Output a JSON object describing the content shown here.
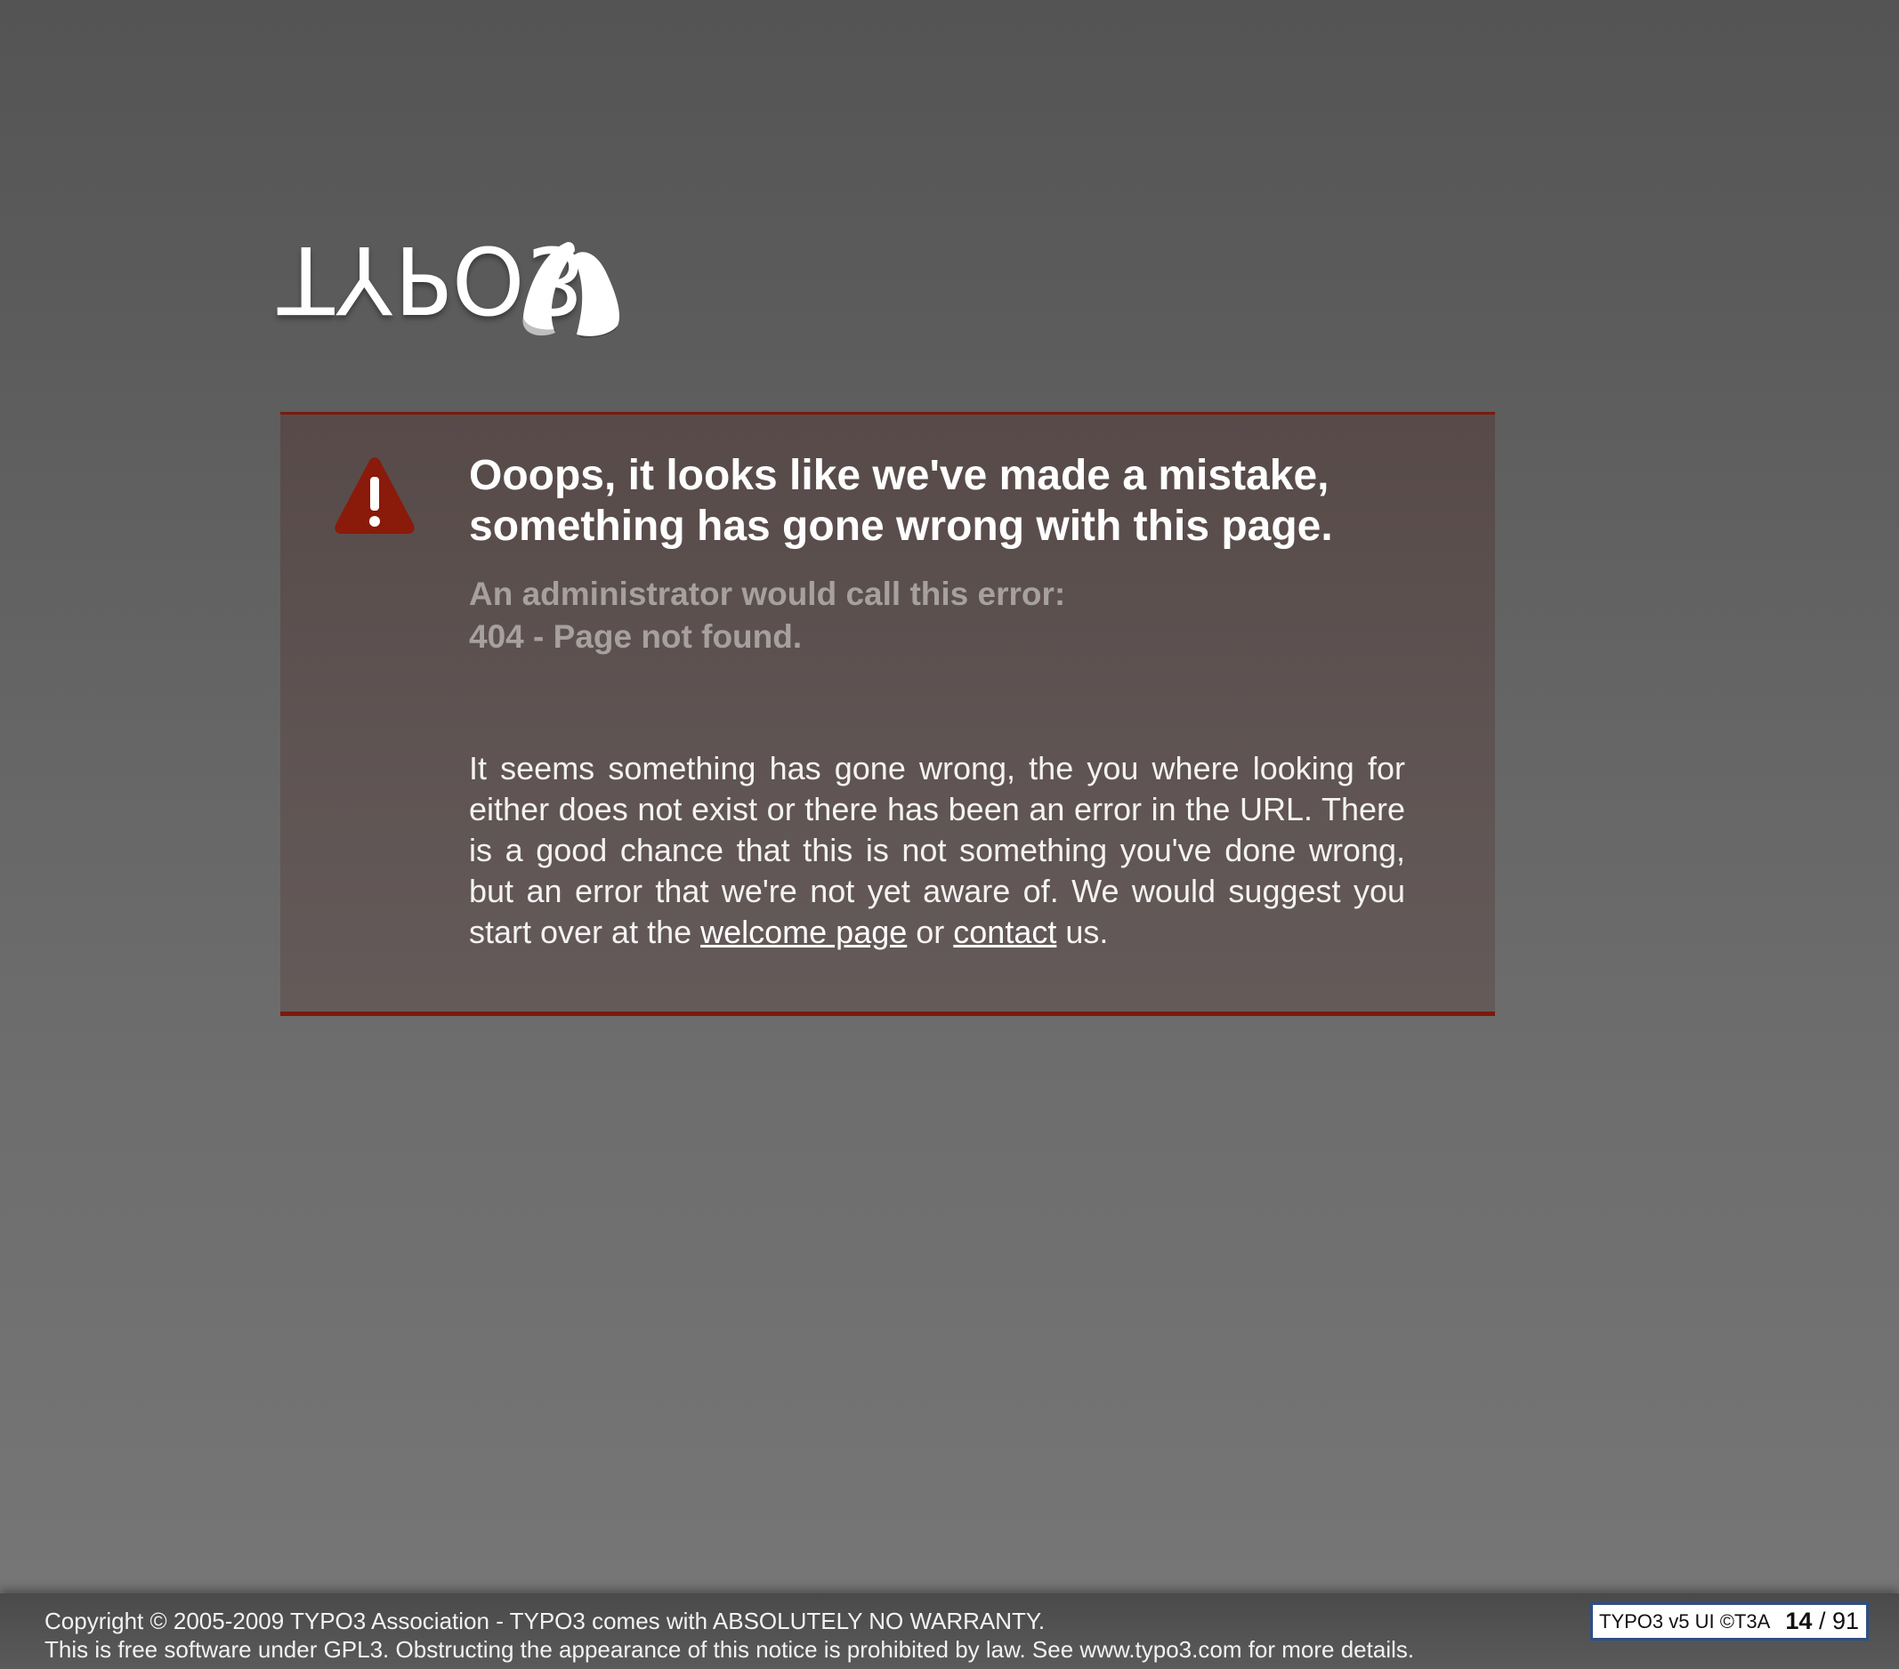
{
  "logo": {
    "wordmark": "TYPO3",
    "icon": "typo3-logo-mark"
  },
  "error_box": {
    "icon": "warning-icon",
    "headline_line1": "Ooops, it looks like we've made a mistake,",
    "headline_line2": "something has gone wrong with this page.",
    "admin_line1": "An administrator would call this error:",
    "admin_line2": "404 - Page not found.",
    "body_part1": "It seems something has gone wrong, the you where looking for either does not exist or there has been an error in the URL. There is a good chance that this is not something you've done wrong, but an error that we're not yet aware of. We would suggest you start over at the ",
    "welcome_link": "welcome page",
    "body_part2": " or ",
    "contact_link": "contact",
    "body_part3": " us."
  },
  "footer": {
    "copyright_line1": "Copyright © 2005-2009 TYPO3 Association - TYPO3 comes with ABSOLUTELY NO WARRANTY.",
    "copyright_line2": "This is free software under GPL3. Obstructing the appearance of this notice is prohibited by law. See www.typo3.com for more details.",
    "version_label": "TYPO3 v5 UI  ©T3A",
    "page_current": "14",
    "page_separator": " / ",
    "page_total": "91"
  },
  "colors": {
    "accent_red": "#7a1a0c",
    "badge_border": "#2d4f86"
  }
}
